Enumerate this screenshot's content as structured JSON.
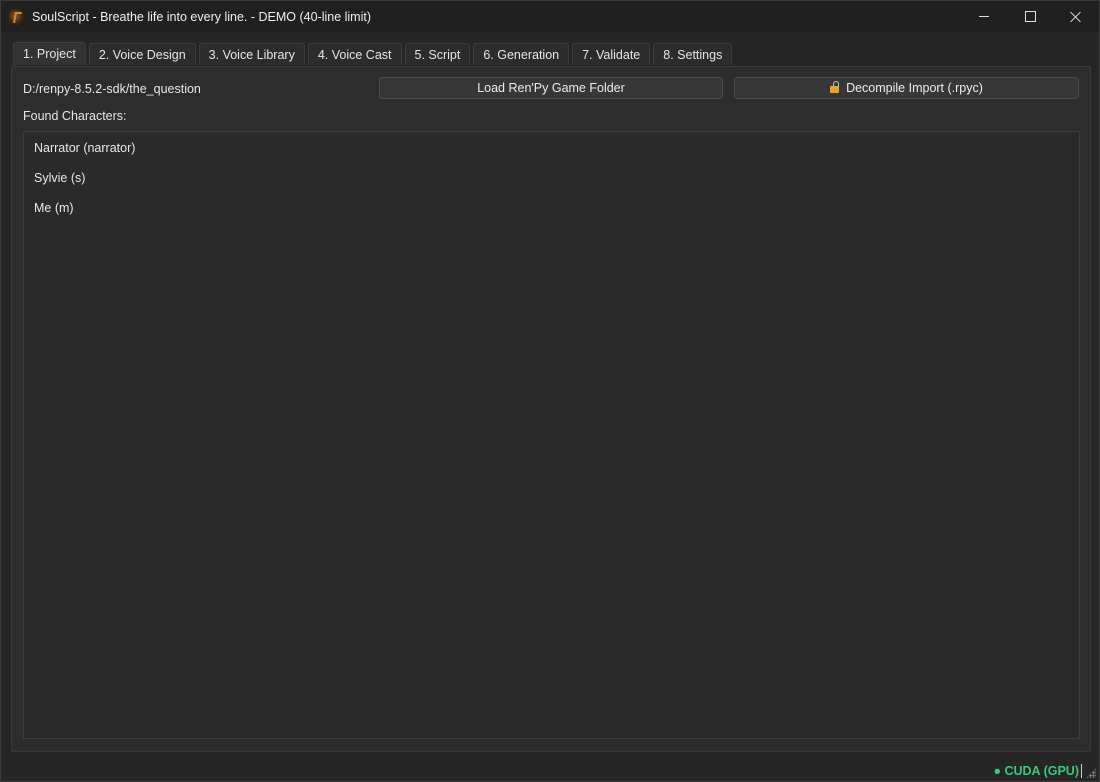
{
  "window": {
    "title": "SoulScript - Breathe life into every line. - DEMO (40-line limit)",
    "icon": "soulscript-logo-icon"
  },
  "tabs": [
    {
      "label": "1. Project",
      "active": true
    },
    {
      "label": "2. Voice Design"
    },
    {
      "label": "3. Voice Library"
    },
    {
      "label": "4. Voice Cast"
    },
    {
      "label": "5. Script"
    },
    {
      "label": "6. Generation"
    },
    {
      "label": "7. Validate"
    },
    {
      "label": "8. Settings"
    }
  ],
  "project": {
    "path": "D:/renpy-8.5.2-sdk/the_question",
    "load_button": "Load Ren'Py Game Folder",
    "decompile_button": "Decompile  Import (.rpyc)",
    "decompile_icon": "unlock-icon",
    "found_label": "Found Characters:",
    "characters": [
      "Narrator (narrator)",
      "Sylvie (s)",
      "Me (m)"
    ]
  },
  "status": {
    "gpu": "● CUDA (GPU)",
    "gpu_color": "#3cc878"
  }
}
